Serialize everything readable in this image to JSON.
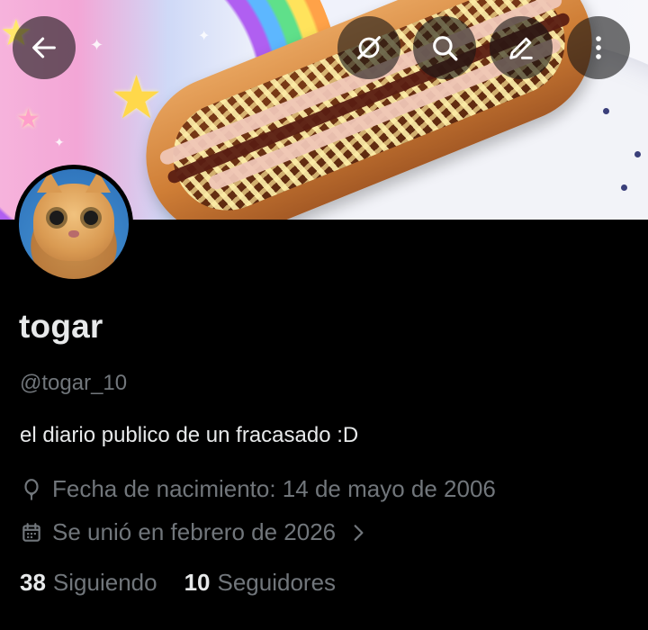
{
  "header": {
    "back_icon": "arrow-left-icon",
    "actions": [
      {
        "name": "grok-icon"
      },
      {
        "name": "search-icon"
      },
      {
        "name": "edit-icon"
      },
      {
        "name": "more-vertical-icon"
      }
    ]
  },
  "profile": {
    "display_name": "togar",
    "handle": "@togar_10",
    "bio": "el diario publico de un fracasado :D",
    "birthdate": "Fecha de nacimiento: 14 de mayo de 2006",
    "joined": "Se unió en febrero de 2026",
    "following_count": "38",
    "following_label": "Siguiendo",
    "followers_count": "10",
    "followers_label": "Seguidores"
  },
  "colors": {
    "background": "#000000",
    "primary_text": "#e7e9ea",
    "secondary_text": "#71767b"
  }
}
